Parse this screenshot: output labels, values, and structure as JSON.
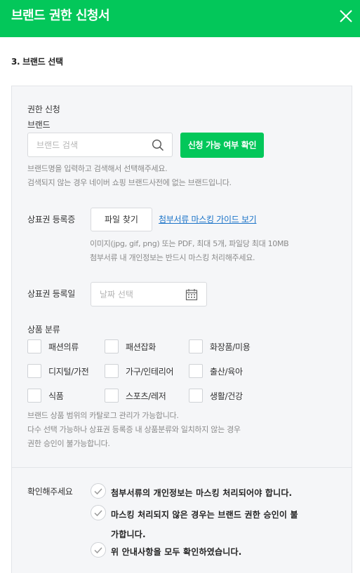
{
  "header": {
    "title": "브랜드 권한 신청서"
  },
  "section": {
    "title": "3. 브랜드 선택"
  },
  "brand": {
    "group_label": "권한 신청",
    "label": "브랜드",
    "search_placeholder": "브랜드 검색",
    "check_button": "신청 가능 여부 확인",
    "help": [
      "브랜드명을 입력하고 검색해서 선택해주세요.",
      "검색되지 않는 경우 네이버 쇼핑 브랜드사전에 없는 브랜드입니다."
    ]
  },
  "trademark": {
    "label": "상표권 등록증",
    "file_button": "파일 찾기",
    "guide_link": "첨부서류 마스킹 가이드 보기",
    "help": [
      "이미지(jpg, gif, png) 또는 PDF, 최대 5개, 파일당 최대 10MB",
      "첨부서류 내 개인정보는 반드시 마스킹 처리해주세요."
    ]
  },
  "registration_date": {
    "label": "상표권 등록일",
    "placeholder": "날짜 선택"
  },
  "category": {
    "label": "상품 분류",
    "items": [
      "패션의류",
      "패션잡화",
      "화장품/미용",
      "디지털/가전",
      "가구/인테리어",
      "출산/육아",
      "식품",
      "스포츠/레저",
      "생활/건강"
    ],
    "help": [
      "브랜드 상품 범위의 카탈로그 관리가 가능합니다.",
      "다수 선택 가능하나 상표권 등록증 내 상품분류와 일치하지 않는 경우",
      "권한 승인이 불가능합니다."
    ]
  },
  "confirm": {
    "label": "확인해주세요",
    "items": [
      "첨부서류의 개인정보는 마스킹 처리되어야 합니다.",
      "마스킹 처리되지 않은 경우는 브랜드 권한 승인이 불",
      "가합니다.",
      "위 안내사항을 모두 확인하였습니다."
    ]
  },
  "colors": {
    "accent": "#03c75a",
    "link": "#1a73c8",
    "panel_bg": "#f5f6f8"
  }
}
